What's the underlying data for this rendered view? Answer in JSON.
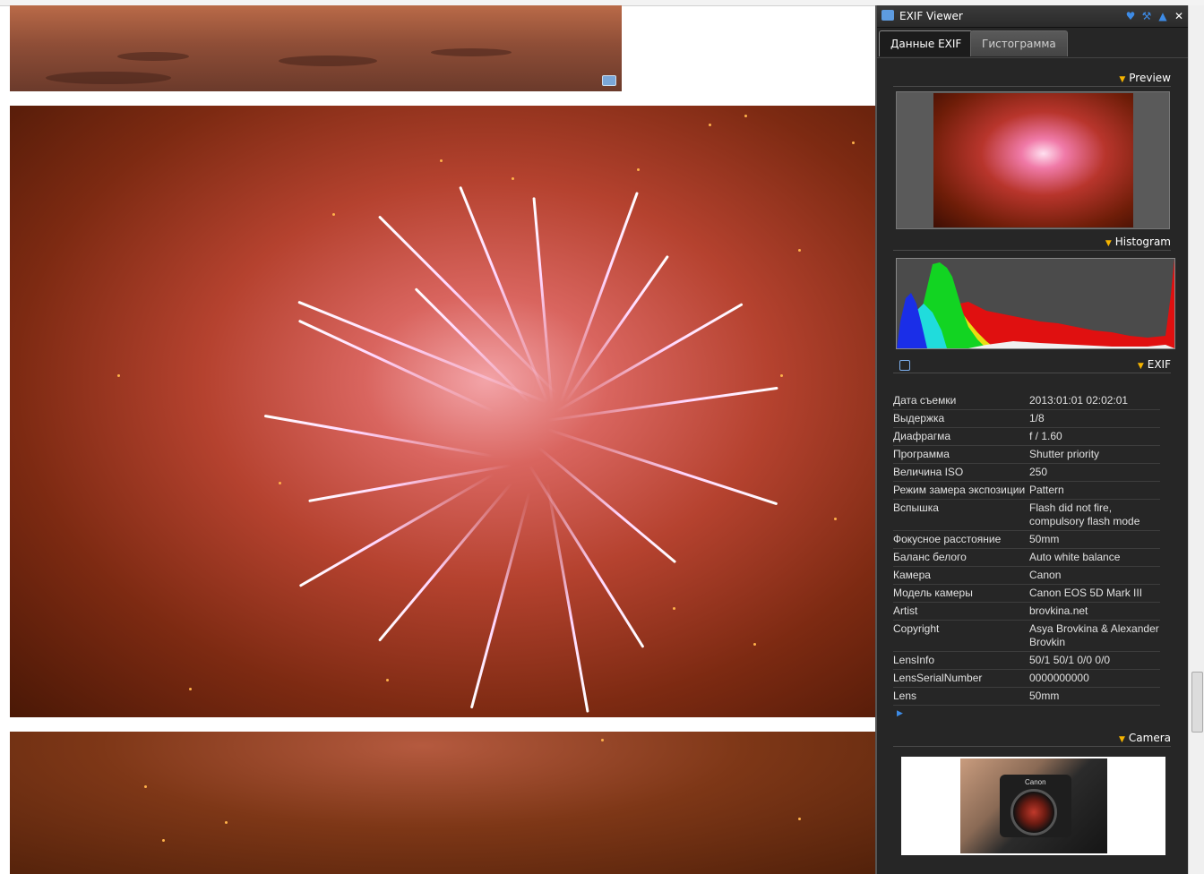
{
  "window": {
    "title": "EXIF Viewer"
  },
  "tabs": [
    {
      "label": "Данные EXIF",
      "active": true
    },
    {
      "label": "Гистограмма",
      "active": false
    }
  ],
  "sections": {
    "preview": "Preview",
    "histogram": "Histogram",
    "exif": "EXIF",
    "camera": "Camera"
  },
  "exif_rows": [
    {
      "key": "Дата съемки",
      "value": "2013:01:01 02:02:01"
    },
    {
      "key": "Выдержка",
      "value": "1/8"
    },
    {
      "key": "Диафрагма",
      "value": "f / 1.60"
    },
    {
      "key": "Программа",
      "value": "Shutter priority"
    },
    {
      "key": "Величина ISO",
      "value": "250"
    },
    {
      "key": "Режим замера экспозиции",
      "value": "Pattern"
    },
    {
      "key": "Вспышка",
      "value": "Flash did not fire, compulsory flash mode"
    },
    {
      "key": "Фокусное расстояние",
      "value": "50mm"
    },
    {
      "key": "Баланс белого",
      "value": "Auto white balance"
    },
    {
      "key": "Камера",
      "value": "Canon"
    },
    {
      "key": "Модель камеры",
      "value": "Canon EOS 5D Mark III"
    },
    {
      "key": "Artist",
      "value": "brovkina.net"
    },
    {
      "key": "Copyright",
      "value": "Asya Brovkina & Alexander Brovkin"
    },
    {
      "key": "LensInfo",
      "value": "50/1 50/1 0/0 0/0"
    },
    {
      "key": "LensSerialNumber",
      "value": "0000000000"
    },
    {
      "key": "Lens",
      "value": "50mm"
    }
  ],
  "camera_brand": "Canon",
  "icons": {
    "titlebar": [
      "heart-icon",
      "wrench-icon",
      "warning-icon",
      "close-icon"
    ],
    "accent": "#f5b400",
    "link_blue": "#3d8be6"
  }
}
